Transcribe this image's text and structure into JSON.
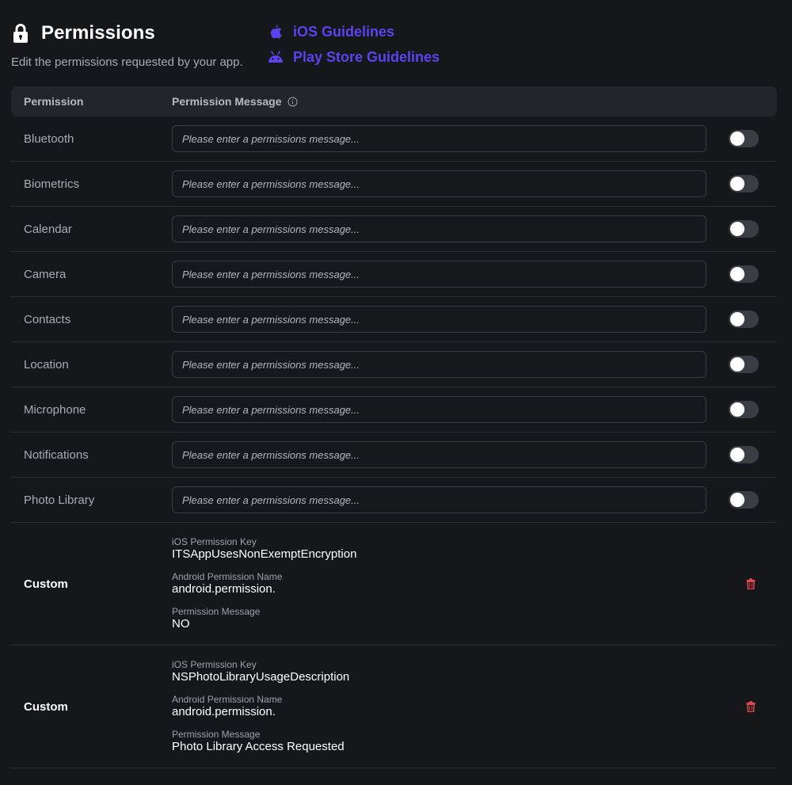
{
  "header": {
    "title": "Permissions",
    "subtitle": "Edit the permissions requested by your app.",
    "icon": "lock-icon"
  },
  "guidelines": [
    {
      "label": "iOS Guidelines",
      "icon": "apple-icon",
      "color": "#5a44f0"
    },
    {
      "label": "Play Store Guidelines",
      "icon": "android-icon",
      "color": "#5a44f0"
    }
  ],
  "table": {
    "columns": [
      "Permission",
      "Permission Message"
    ],
    "placeholder": "Please enter a permissions message...",
    "rows": [
      {
        "label": "Bluetooth",
        "enabled": false
      },
      {
        "label": "Biometrics",
        "enabled": false
      },
      {
        "label": "Calendar",
        "enabled": false
      },
      {
        "label": "Camera",
        "enabled": false
      },
      {
        "label": "Contacts",
        "enabled": false
      },
      {
        "label": "Location",
        "enabled": false
      },
      {
        "label": "Microphone",
        "enabled": false
      },
      {
        "label": "Notifications",
        "enabled": false
      },
      {
        "label": "Photo Library",
        "enabled": false
      }
    ],
    "custom": [
      {
        "label": "Custom",
        "ios_key_label": "iOS Permission Key",
        "ios_key": "ITSAppUsesNonExemptEncryption",
        "android_label": "Android Permission Name",
        "android_name": "android.permission.",
        "message_label": "Permission Message",
        "message": "NO"
      },
      {
        "label": "Custom",
        "ios_key_label": "iOS Permission Key",
        "ios_key": "NSPhotoLibraryUsageDescription",
        "android_label": "Android Permission Name",
        "android_name": "android.permission.",
        "message_label": "Permission Message",
        "message": "Photo Library Access Requested"
      }
    ]
  },
  "colors": {
    "accent": "#5a44f0",
    "danger": "#e5484d",
    "background": "#16171b"
  }
}
